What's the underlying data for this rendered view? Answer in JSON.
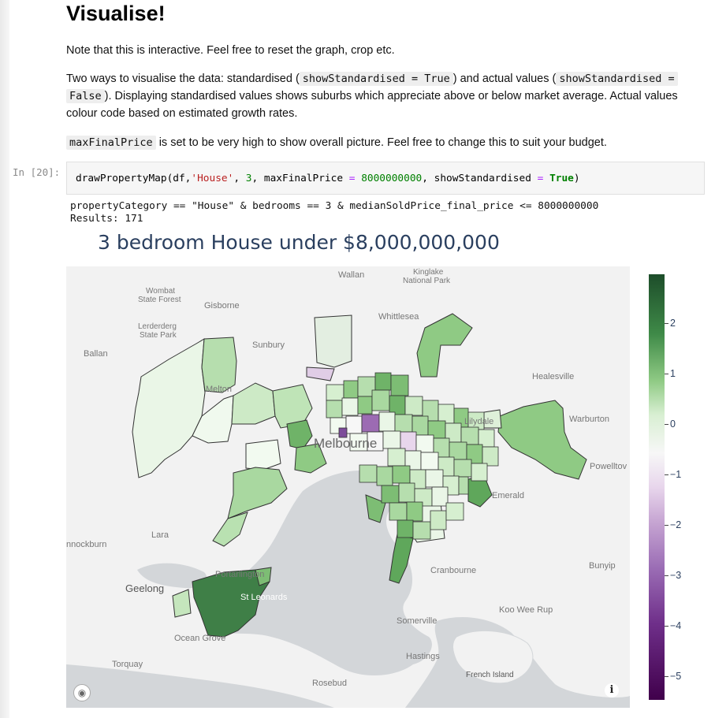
{
  "heading": "Visualise!",
  "para1": "Note that this is interactive. Feel free to reset the graph, crop etc.",
  "para2": {
    "t1": "Two ways to visualise the data: standardised (",
    "c1": "showStandardised = True",
    "t2": ") and actual values (",
    "c2a": "showStandardised =",
    "c2b": "False",
    "t3": "). Displaying standardised values shows suburbs which appreciate above or below market average. Actual values colour code based on estimated growth rates."
  },
  "para3": {
    "code": "maxFinalPrice",
    "text": " is set to be very high to show overall picture. Feel free to change this to suit your budget."
  },
  "cell": {
    "prompt": "In [20]:",
    "fn": "drawPropertyMap(df,",
    "arg_str": "'House'",
    "sep1": ", ",
    "arg_num": "3",
    "sep2": ", maxFinalPrice ",
    "eq1": "=",
    "sp1": " ",
    "price": "8000000000",
    "sep3": ", showStandardised ",
    "eq2": "=",
    "sp2": " ",
    "bool": "True",
    "close": ")"
  },
  "output": {
    "line1": "propertyCategory == \"House\" & bedrooms == 3 & medianSoldPrice_final_price <= 8000000000",
    "line2": "Results: 171"
  },
  "plot_title": "3 bedroom House under $8,000,000,000",
  "map_labels": {
    "wallan": "Wallan",
    "kinglake": "Kinglake",
    "kinglake2": "National Park",
    "wombat": "Wombat",
    "wombat2": "State Forest",
    "gisborne": "Gisborne",
    "whittlesea": "Whittlesea",
    "lerderderg": "Lerderderg",
    "lerderderg2": "State Park",
    "sunbury": "Sunbury",
    "ballan": "Ballan",
    "healesville": "Healesville",
    "melton": "Melton",
    "lilydale": "Lilydale",
    "warburton": "Warburton",
    "melbourne": "Melbourne",
    "powelltown": "Powelltov",
    "emerald": "Emerald",
    "lara": "Lara",
    "anakie": "nnockburn",
    "bunyip": "Bunyip",
    "cranbourne": "Cranbourne",
    "portarlington": "Portarlington",
    "geelong": "Geelong",
    "stleonards": "St Leonards",
    "kooweerup": "Koo Wee Rup",
    "somerville": "Somerville",
    "oceangrove": "Ocean Grove",
    "hastings": "Hastings",
    "torquay": "Torquay",
    "frenchisland": "French Island",
    "rosebud": "Rosebud"
  },
  "colorbar_ticks": [
    "2",
    "1",
    "0",
    "−1",
    "−2",
    "−3",
    "−4",
    "−5"
  ],
  "colors": {
    "colorscale": [
      "#40004b",
      "#9b6db5",
      "#f7f7f7",
      "#8fca84",
      "#1d4d2a"
    ],
    "water": "#d3d6d9",
    "land": "#f2f2f2",
    "title": "#2a3f5f"
  },
  "icons": {
    "mapbox": "mapbox-logo-icon",
    "info": "info-icon"
  }
}
